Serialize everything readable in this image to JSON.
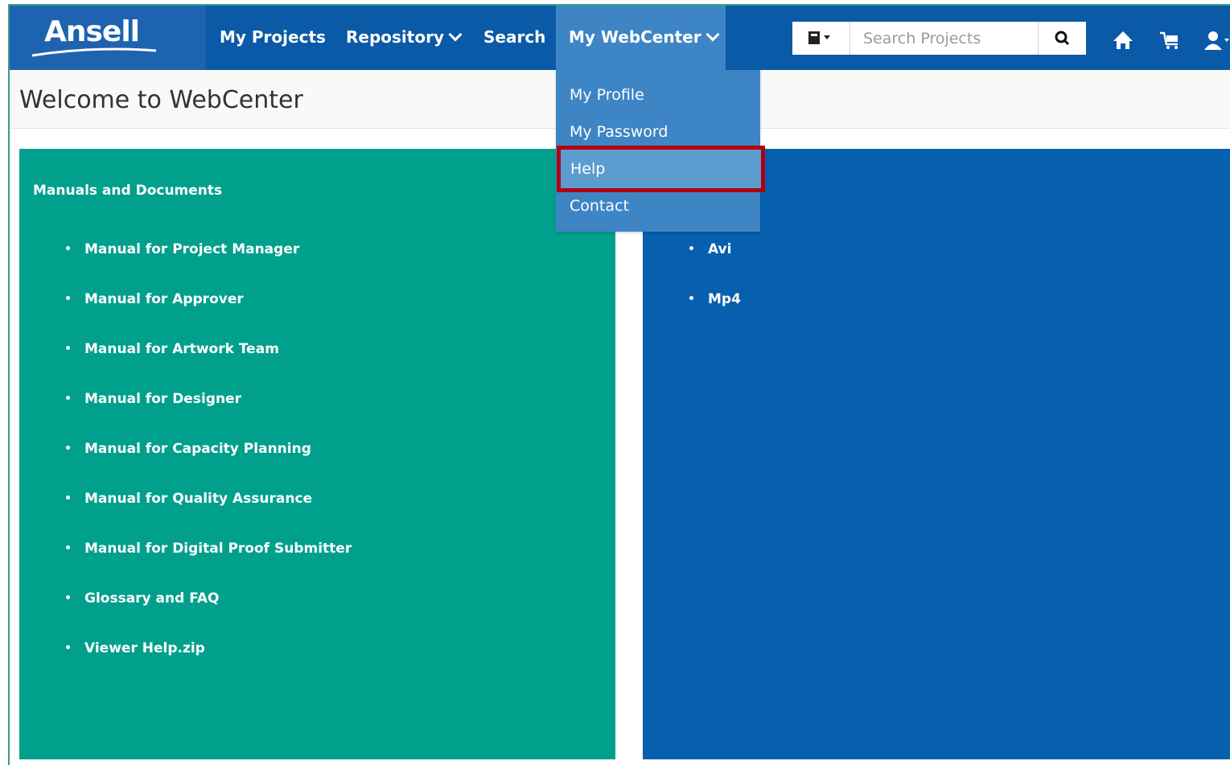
{
  "app": {
    "logo_text": "Ansell"
  },
  "nav": {
    "items": [
      {
        "label": "My Projects",
        "has_caret": false
      },
      {
        "label": "Repository",
        "has_caret": true
      },
      {
        "label": "Search",
        "has_caret": false
      },
      {
        "label": "My WebCenter",
        "has_caret": true,
        "active": true
      }
    ]
  },
  "search": {
    "placeholder": "Search Projects",
    "type_icon": "document-type-icon",
    "button_icon": "search-icon"
  },
  "toolbar_icons": [
    "home-icon",
    "cart-icon",
    "user-icon"
  ],
  "header": {
    "title": "Welcome to WebCenter"
  },
  "dropdown": {
    "items": [
      {
        "label": "My Profile"
      },
      {
        "label": "My Password"
      },
      {
        "label": "Help",
        "highlighted": true
      },
      {
        "label": "Contact"
      }
    ]
  },
  "manuals_panel": {
    "heading": "Manuals and Documents",
    "items": [
      "Manual for Project Manager",
      "Manual for Approver",
      "Manual for Artwork Team",
      "Manual for Designer",
      "Manual for Capacity Planning",
      "Manual for Quality Assurance",
      "Manual for Digital Proof Submitter",
      "Glossary and FAQ",
      "Viewer Help.zip"
    ]
  },
  "videos_panel": {
    "items": [
      "Avi",
      "Mp4"
    ]
  },
  "colors": {
    "nav_bg": "#0b5aa7",
    "nav_active": "#3e85c5",
    "green_panel": "#00a08d",
    "blue_panel": "#0660ae",
    "highlight_border": "#b00010"
  }
}
